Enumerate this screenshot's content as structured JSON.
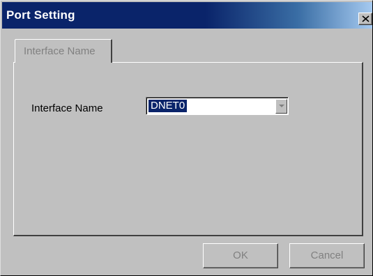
{
  "window": {
    "title": "Port Setting"
  },
  "tabs": [
    {
      "label": "Interface Name",
      "active": true
    }
  ],
  "form": {
    "interface_name_label": "Interface Name",
    "interface_name_value": "DNET0"
  },
  "buttons": {
    "ok_label": "OK",
    "cancel_label": "Cancel"
  },
  "icons": {
    "close": "close-icon",
    "dropdown": "chevron-down-icon"
  },
  "colors": {
    "titlebar": "#0a246a",
    "face": "#c0c0c0",
    "selection": "#0a246a"
  }
}
